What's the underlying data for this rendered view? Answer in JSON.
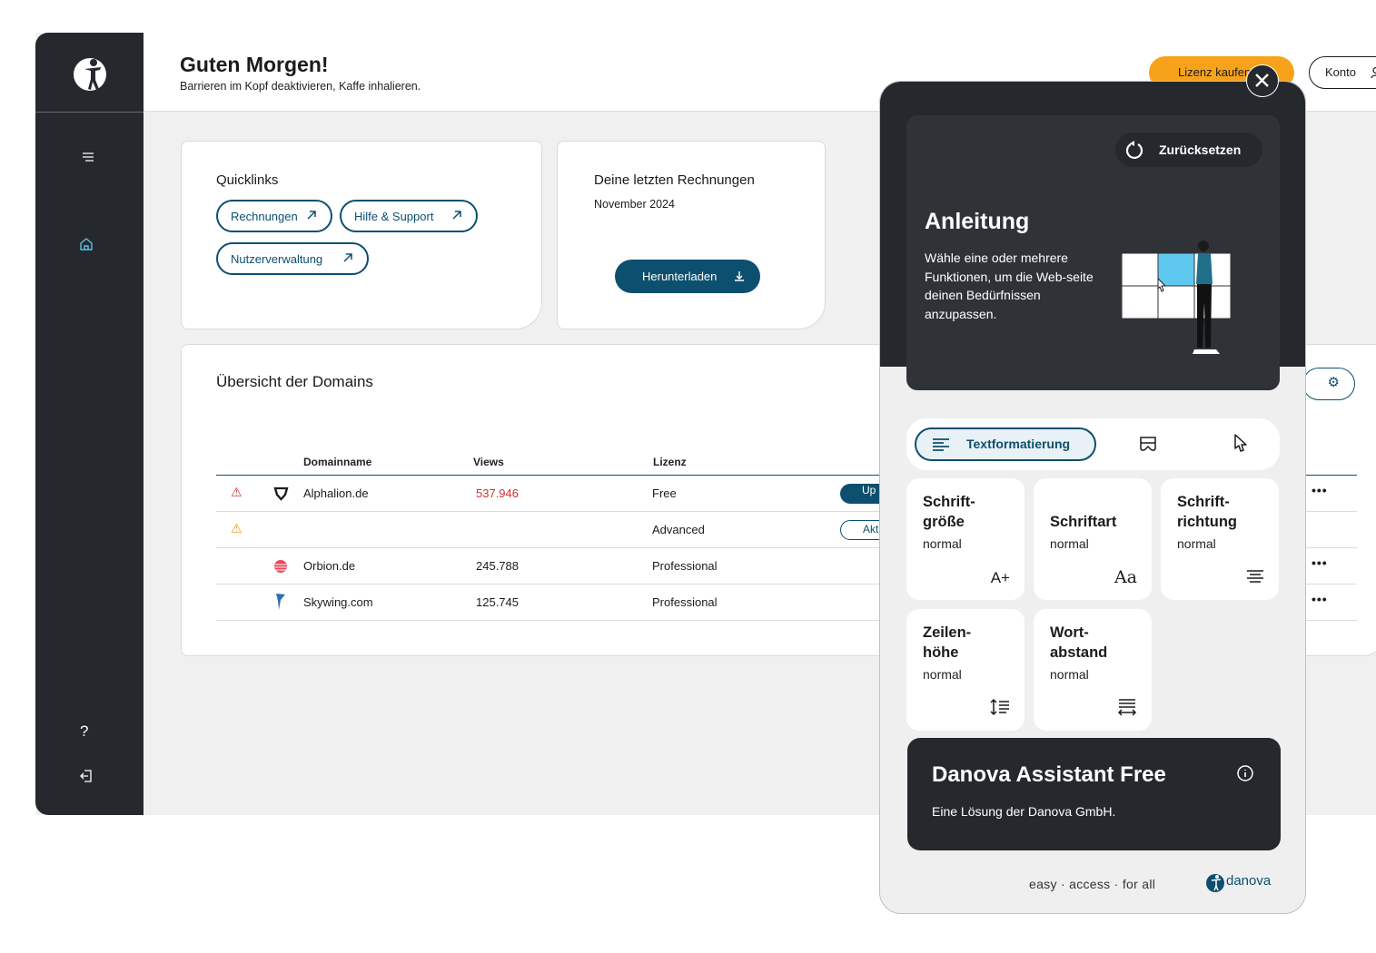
{
  "header": {
    "greeting": "Guten Morgen!",
    "subtitle": "Barrieren im Kopf deaktivieren, Kaffe inhalieren.",
    "license_button": "Lizenz kaufen",
    "account_button": "Konto"
  },
  "quicklinks": {
    "title": "Quicklinks",
    "links": [
      "Rechnungen",
      "Hilfe & Support",
      "Nutzerverwaltung"
    ]
  },
  "invoices": {
    "title": "Deine letzten Rechnungen",
    "month": "November 2024",
    "download_label": "Herunterladen"
  },
  "domains": {
    "title": "Übersicht der Domains",
    "columns": [
      "Domainname",
      "Views",
      "Lizenz"
    ],
    "rows": [
      {
        "name": "Alphalion.de",
        "views": "537.946",
        "license": "Free",
        "action": "Up",
        "warning": "red"
      },
      {
        "name": "",
        "views": "",
        "license": "Advanced",
        "action": "Akti",
        "warning": "orange"
      },
      {
        "name": "Orbion.de",
        "views": "245.788",
        "license": "Professional",
        "action": "",
        "warning": ""
      },
      {
        "name": "Skywing.com",
        "views": "125.745",
        "license": "Professional",
        "action": "",
        "warning": ""
      }
    ],
    "more": "•••"
  },
  "widget": {
    "reset_label": "Zurücksetzen",
    "guide_title": "Anleitung",
    "guide_text": "Wähle eine oder mehrere Funktionen,  um die Web-seite deinen Bedürfnissen anzupassen.",
    "tab_active": "Textformatierung",
    "tiles": [
      {
        "title1": "Schrift-",
        "title2": "größe",
        "value": "normal",
        "icon": "A+"
      },
      {
        "title1": "Schriftart",
        "title2": "",
        "value": "normal",
        "icon": "Aa"
      },
      {
        "title1": "Schrift-",
        "title2": "richtung",
        "value": "normal",
        "icon": "align-center-icon"
      },
      {
        "title1": "Zeilen-",
        "title2": "höhe",
        "value": "normal",
        "icon": "line-height-icon"
      },
      {
        "title1": "Wort-",
        "title2": "abstand",
        "value": "normal",
        "icon": "word-spacing-icon"
      }
    ],
    "assistant_title": "Danova Assistant Free",
    "assistant_sub": "Eine Lösung der Danova GmbH.",
    "tagline": "easy · access · for all",
    "brand": "danova"
  },
  "colors": {
    "dark": "#25282d",
    "primary": "#0d4f6e",
    "accent": "#f7a21b",
    "warning_red": "#d32f2f",
    "warning_orange": "#f29a1e",
    "views_red": "#d32f2f"
  }
}
